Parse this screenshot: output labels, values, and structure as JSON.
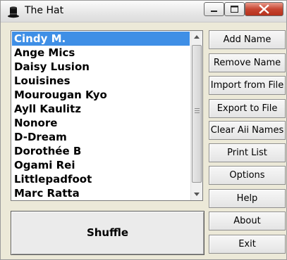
{
  "window": {
    "title": "The Hat",
    "icon": "top-hat-icon",
    "controls": [
      "minimize-icon",
      "maximize-icon",
      "close-icon"
    ],
    "close_color": "#c74531"
  },
  "names_list": {
    "selected_index": 0,
    "selection_color": "#3f8fe6",
    "items": [
      {
        "label": "Cindy M."
      },
      {
        "label": "Ange Mics"
      },
      {
        "label": "Daisy Lusion"
      },
      {
        "label": "Louisines"
      },
      {
        "label": "Mourougan Kyo"
      },
      {
        "label": "Ayll Kaulitz"
      },
      {
        "label": "Nonore"
      },
      {
        "label": "D-Dream"
      },
      {
        "label": "Dorothée B"
      },
      {
        "label": "Ogami Rei"
      },
      {
        "label": "Littlepadfoot"
      },
      {
        "label": "Marc Ratta"
      }
    ]
  },
  "buttons": {
    "add_name": "Add Name",
    "remove_name": "Remove Name",
    "import_from_file": "Import from File",
    "export_to_file": "Export to File",
    "clear_all_names": "Clear Aii Names",
    "print_list": "Print List",
    "options": "Options",
    "help": "Help",
    "about": "About",
    "exit": "Exit",
    "shuffle": "Shuffle"
  }
}
